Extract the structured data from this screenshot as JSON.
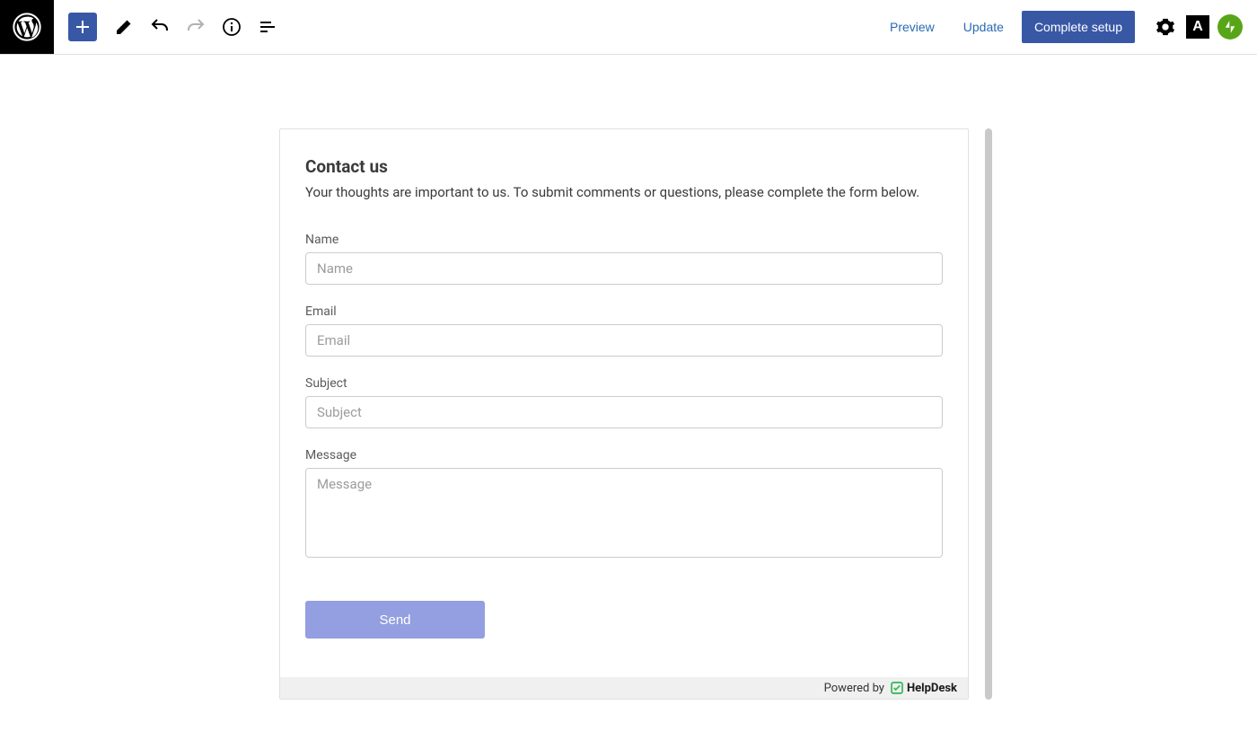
{
  "toolbar": {
    "preview": "Preview",
    "update": "Update",
    "complete": "Complete setup"
  },
  "form": {
    "title": "Contact us",
    "intro": "Your thoughts are important to us. To submit comments or questions, please complete the form below.",
    "name_label": "Name",
    "name_placeholder": "Name",
    "email_label": "Email",
    "email_placeholder": "Email",
    "subject_label": "Subject",
    "subject_placeholder": "Subject",
    "message_label": "Message",
    "message_placeholder": "Message",
    "send": "Send"
  },
  "footer": {
    "powered_by": "Powered by",
    "brand": "HelpDesk"
  }
}
